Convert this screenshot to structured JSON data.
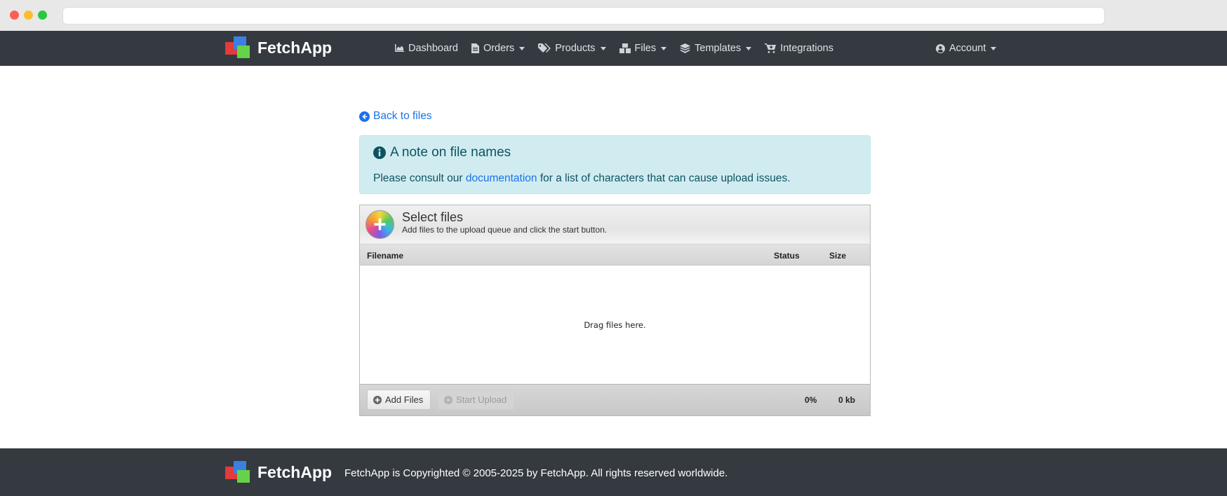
{
  "nav": {
    "brand": "FetchApp",
    "items": [
      {
        "label": "Dashboard",
        "icon": "chart-area-icon",
        "dropdown": false
      },
      {
        "label": "Orders",
        "icon": "file-invoice-icon",
        "dropdown": true
      },
      {
        "label": "Products",
        "icon": "tags-icon",
        "dropdown": true
      },
      {
        "label": "Files",
        "icon": "boxes-icon",
        "dropdown": true
      },
      {
        "label": "Templates",
        "icon": "layers-icon",
        "dropdown": true
      },
      {
        "label": "Integrations",
        "icon": "cart-plus-icon",
        "dropdown": false
      }
    ],
    "account": {
      "label": "Account",
      "icon": "user-circle-icon"
    }
  },
  "content": {
    "back_label": "Back to files",
    "alert": {
      "title": "A note on file names",
      "body_pre": "Please consult our",
      "link": "documentation",
      "body_post": "for a list of characters that can cause upload issues."
    }
  },
  "uploader": {
    "title": "Select files",
    "subtitle": "Add files to the upload queue and click the start button.",
    "columns": {
      "filename": "Filename",
      "status": "Status",
      "size": "Size"
    },
    "drop_text": "Drag files here.",
    "add_label": "Add Files",
    "start_label": "Start Upload",
    "progress": "0%",
    "total_size": "0 kb"
  },
  "footer": {
    "brand": "FetchApp",
    "copyright": "FetchApp is Copyrighted © 2005-2025 by FetchApp. All rights reserved worldwide."
  },
  "colors": {
    "navbar": "#343a40",
    "link": "#1a73e8",
    "alert_bg": "#d1ecf1",
    "alert_text": "#0c5460"
  }
}
